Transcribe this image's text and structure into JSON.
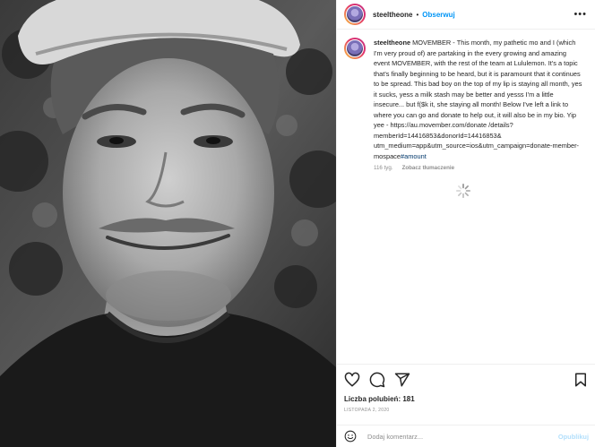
{
  "post": {
    "username": "steeltheone",
    "dot": "•",
    "follow_label": "Obserwuj",
    "more_label": "•••"
  },
  "caption": {
    "username": "steeltheone",
    "text": "MOVEMBER - This month, my pathetic mo and I (which I'm very proud of) are partaking in the every growing and amazing event MOVEMBER, with the rest of the team at Lululemon. It's a topic that's finally beginning to be heard, but it is paramount that it continues to be spread. This bad boy on the top of my lip is staying all month, yes it sucks, yess a milk stash may be better and yesss I'm a little insecure... but f($k it, she staying all month! Below I've left a link to where you can go and donate to help out, it will also be in my bio. Yip yee - https://au.movember.com/donate /details?memberId=14416853&donorId=14416853& utm_medium=app&utm_source=ios&utm_campaign=donate-member-mospace",
    "hashtag": "#amount",
    "age": "116 tyg.",
    "translate_label": "Zobacz tłumaczenie"
  },
  "actions": {
    "likes_text": "Liczba polubień: 181",
    "date": "LISTOPADA 2, 2020"
  },
  "comment": {
    "placeholder": "Dodaj komentarz...",
    "post_label": "Opublikuj"
  },
  "icons": [
    "heart-icon",
    "comment-icon",
    "share-icon",
    "bookmark-icon",
    "emoji-icon",
    "loading-spinner-icon"
  ],
  "colors": {
    "link": "#0095f6",
    "hashtag": "#00376b",
    "muted": "#8e8e8e",
    "post_disabled": "#b2dffc",
    "text": "#262626"
  }
}
